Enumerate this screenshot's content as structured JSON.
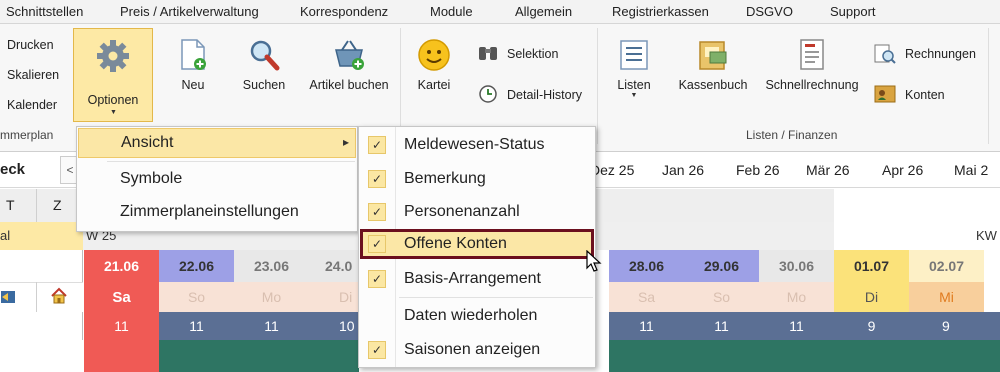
{
  "menubar": [
    "Schnittstellen",
    "Preis / Artikelverwaltung",
    "Korrespondenz",
    "Module",
    "Allgemein",
    "Registrierkassen",
    "DSGVO",
    "Support"
  ],
  "ribbon": {
    "left_items": [
      "Drucken",
      "Skalieren",
      "Kalender"
    ],
    "left_group": "mmerplan",
    "optionen": "Optionen",
    "neu": "Neu",
    "suchen": "Suchen",
    "artikel_buchen": "Artikel buchen",
    "kartei": "Kartei",
    "selektion": "Selektion",
    "detail_history": "Detail-History",
    "listen": "Listen",
    "kassenbuch": "Kassenbuch",
    "schnellrechnung": "Schnellrechnung",
    "rechnungen": "Rechnungen",
    "konten": "Konten",
    "group_listen": "Listen / Finanzen"
  },
  "calendar": {
    "left_label": "eck",
    "left_nav": "<",
    "months": [
      "Dez 25",
      "Jan 26",
      "Feb 26",
      "Mär 26",
      "Apr 26",
      "Mai 2"
    ],
    "col_t": "T",
    "col_z": "Z",
    "row_al": "al",
    "week_left": "W 25",
    "week_right": "KW",
    "days": [
      {
        "date": "21.06",
        "wd": "Sa",
        "count": "11"
      },
      {
        "date": "22.06",
        "wd": "So",
        "count": "11"
      },
      {
        "date": "23.06",
        "wd": "Mo",
        "count": "11"
      },
      {
        "date": "24.0",
        "wd": "Di",
        "count": "10"
      },
      {
        "date": "28.06",
        "wd": "Sa",
        "count": "11"
      },
      {
        "date": "29.06",
        "wd": "So",
        "count": "11"
      },
      {
        "date": "30.06",
        "wd": "Mo",
        "count": "11"
      },
      {
        "date": "01.07",
        "wd": "Di",
        "count": "9"
      },
      {
        "date": "02.07",
        "wd": "Mi",
        "count": "9"
      }
    ]
  },
  "menu_main": {
    "items": [
      "Ansicht",
      "Symbole",
      "Zimmerplaneinstellungen"
    ],
    "arrow": "▸"
  },
  "menu_sub": {
    "items": [
      {
        "label": "Meldewesen-Status",
        "checked": true
      },
      {
        "label": "Bemerkung",
        "checked": true
      },
      {
        "label": "Personenanzahl",
        "checked": true
      },
      {
        "label": "Offene Konten",
        "checked": true
      },
      {
        "label": "Basis-Arrangement",
        "checked": true
      },
      {
        "label": "Daten wiederholen",
        "checked": false
      },
      {
        "label": "Saisonen anzeigen",
        "checked": true
      }
    ],
    "check_glyph": "✓"
  }
}
